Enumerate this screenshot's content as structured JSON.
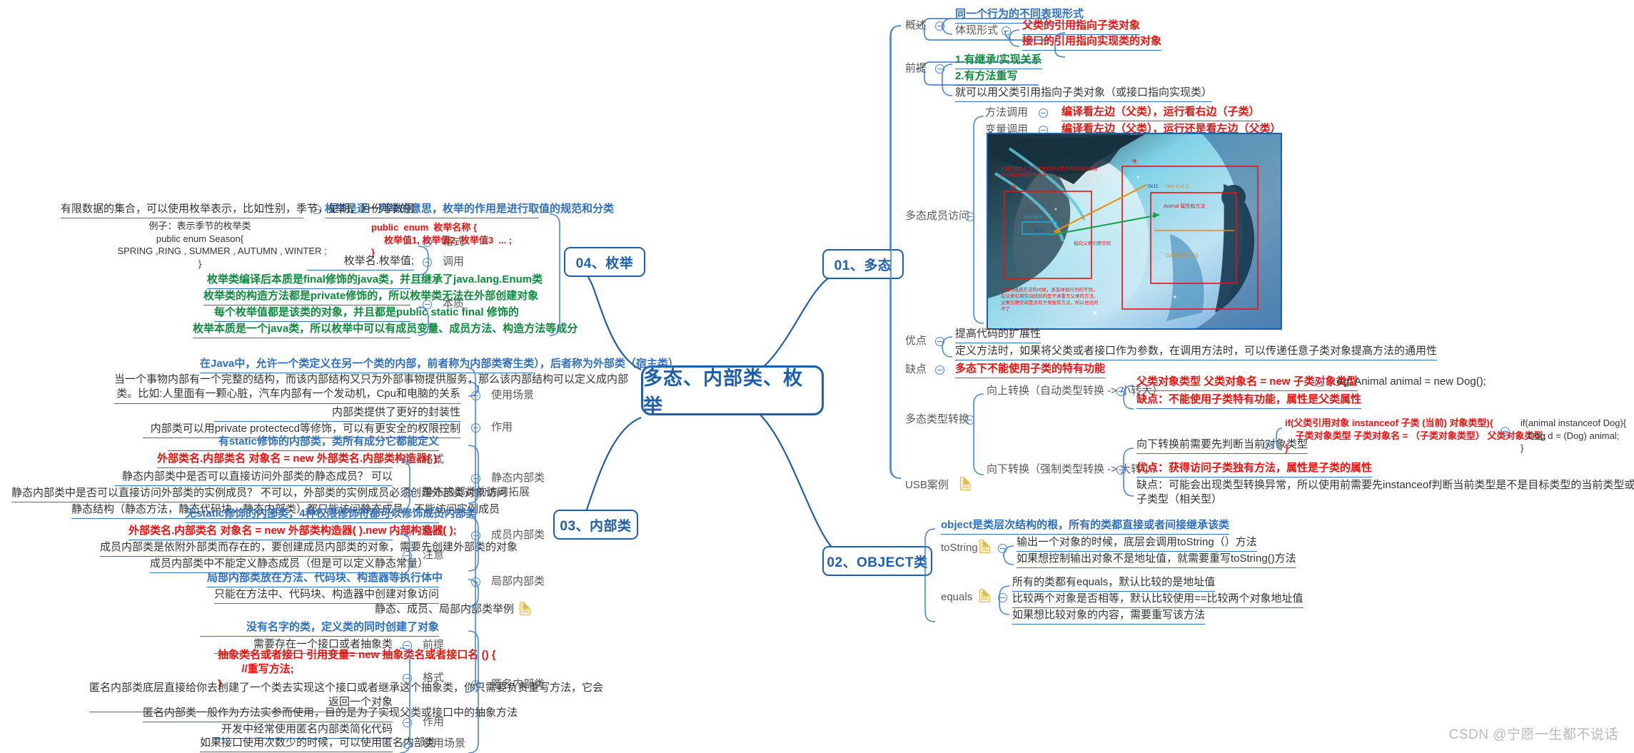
{
  "root": {
    "label": "多态、内部类、枚举"
  },
  "watermark": "CSDN @宁愿一生都不说话",
  "topics": [
    {
      "id": "t1",
      "label": "01、多态"
    },
    {
      "id": "t2",
      "label": "02、OBJECT类"
    },
    {
      "id": "t3",
      "label": "03、内部类"
    },
    {
      "id": "t4",
      "label": "04、枚举"
    }
  ],
  "polymorphism": {
    "overview_label": "概述",
    "overview_1": "同一个行为的不同表现形式",
    "form_label": "体现形式",
    "form_1": "父类的引用指向子类对象",
    "form_2": "接口的引用指向实现类的对象",
    "premise_label": "前提",
    "premise_1": "1.有继承/实现关系",
    "premise_2": "2.有方法重写",
    "premise_3": "就可以用父类引用指向子类对象（或接口指向实现类）",
    "member_access_label": "多态成员访问",
    "method_call_label": "方法调用",
    "method_call_value": "编译看左边（父类），运行看右边（子类）",
    "var_call_label": "变量调用",
    "var_call_value": "编译看左边（父类），运行还是看左边（父类）",
    "pros_label": "优点",
    "pros_1": "提高代码的扩展性",
    "pros_2": "定义方法时，如果将父类或者接口作为参数，在调用方法时，可以传递任意子类对象提高方法的通用性",
    "cons_label": "缺点",
    "cons_1": "多态下不能使用子类的特有功能",
    "cast_label": "多态类型转换",
    "up_label": "向上转换（自动类型转换 -> 小转大）",
    "up_format": "父类对象类型 父类对象名 = new 子类对象类型",
    "up_eg": "eg: Animal animal = new Dog();",
    "up_cons": "缺点：不能使用子类特有功能，属性是父类属性",
    "down_label": "向下转换（强制类型转换 -> 大转小）",
    "down_pre_label": "向下转换前需要先判断当前对象类型",
    "down_pre_code": "if(父类引用对象 instanceof 子类 (当前) 对象类型){\n    子类对象类型 子类对象名 = （子类对象类型） 父类对象类型;\n}",
    "down_pre_eg": "if(animal instanceof Dog){\n   Dog d = (Dog) animal;\n}",
    "down_pros": "优点：获得访问子类独有方法，属性是子类的属性",
    "down_cons": "缺点：可能会出现类型转换异常，所以使用前需要先instanceof判断当前类型是不是目标类型的当前类型或者\n子类型（相关型）",
    "usb_label": "USB案例",
    "image": {
      "caption_top": "1.访问成员方法的时候找到父类引用空间的属性\n所以输出的是父类结果",
      "caption_bottom": "2.访问成员方法的时候，多态体现行为的不同，\n在父类引用空间找到的是子类重写父类的方法。\n父类引用空间是没有子类独有方法，所以也访问\n不了",
      "stack_label": "栈",
      "heap_label": "堆",
      "ref_name": "Animal a",
      "ref_addr": "0x11",
      "heap_addr": "0x11",
      "heap_new": "new Cat ()",
      "heap_box1": "Animal 属性和方法",
      "heap_box2": "Cat属性和方法",
      "arrow_note": "指向父类引用空间"
    }
  },
  "object_class": {
    "root_note": "object是类层次结构的根，所有的类都直接或者间接继承该类",
    "tostring_label": "toString",
    "tostring_1": "输出一个对象的时候，底层会调用toString（）方法",
    "tostring_2": "如果想控制输出对象不是地址值，就需要重写toString()方法",
    "equals_label": "equals",
    "equals_1": "所有的类都有equals，默认比较的是地址值",
    "equals_2": "比较两个对象是否相等，默认比较使用==比较两个对象地址值",
    "equals_3": "如果想比较对象的内容，需要重写该方法"
  },
  "inner_class": {
    "def": "在Java中，允许一个类定义在另一个类的内部，前者称为内部类寄生类），后者称为外部类（宿主类）",
    "usecase_label": "使用场景",
    "usecase_1": "当一个事物内部有一个完整的结构，而该内部结构又只为外部事物提供服务，那么该内部结构可以定义成内部\n类。比如:人里面有一颗心脏，汽车内部有一个发动机，Cpu和电脑的关系",
    "role_label": "作用",
    "role_1": "内部类提供了更好的封装性",
    "role_2": "内部类可以用private protectecd等修饰，可以有更安全的权限控制",
    "static_label": "静态内部类",
    "static_def": "有static修饰的内部类，类所有成分它都能定义",
    "static_format_label": "格式",
    "static_format": "外部类名.内部类名 对象名 = new 外部类名.内部类构造器( );",
    "static_access_label": "静态内部类的访问拓展",
    "static_access_1": "静态内部类中是否可以直接访问外部类的静态成员？ 可以",
    "static_access_2": "静态内部类中是否可以直接访问外部类的实例成员？ 不可以，外部类的实例成员必须创建外部类对象访问",
    "static_access_3": "静态结构（静态方法，静态代码块，静态内部类）都只能访问静态成员，不能访问实例成员",
    "member_label": "成员内部类",
    "member_def": "无static修饰的内部类，4种权限修饰符都可以修饰成员内部类",
    "member_format_label": "格式",
    "member_format": "外部类名.内部类名 对象名 = new 外部类构造器( ).new 内部构造器( );",
    "member_note_label": "注意",
    "member_note_1": "成员内部类是依附外部类而存在的，要创建成员内部类的对象，需要先创建外部类的对象",
    "member_note_2": "成员内部类中不能定义静态成员（但是可以定义静态常量）",
    "local_label": "局部内部类",
    "local_1": "局部内部类放在方法、代码块、构造器等执行体中",
    "local_2": "只能在方法中、代码块、构造器中创建对象访问",
    "example_label": "静态、成员、局部内部类举例",
    "anon_label": "匿名内部类",
    "anon_def": "没有名字的类，定义类的同时创建了对象",
    "anon_pre_label": "前提",
    "anon_pre": "需要存在一个接口或者抽象类",
    "anon_format_label": "格式",
    "anon_format": "抽象类名或者接口 引用变量= new 抽象类名或者接口名 () {\n        //重写方法;\n}",
    "anon_note": "匿名内部类底层直接给你去创建了一个类去实现这个接口或者继承这个抽象类，你只需要负责重写方法，它会\n返回一个对象",
    "anon_role_label": "作用",
    "anon_role_1": "匿名内部类一般作为方法实参而使用，目的是为了实现父类或接口中的抽象方法",
    "anon_role_2": "开发中经常使用匿名内部类简化代码",
    "anon_usecase_label": "使用场景",
    "anon_usecase": "如果接口使用次数少的时候，可以使用匿名内部类"
  },
  "enumeration": {
    "def": "枚举是逐一列举的意思，枚举的作用是进行取值的规范和分类",
    "def_left": "有限数据的集合，可以使用枚举表示，比如性别，季节，星期，月份等数据",
    "example": "例子：表示季节的枚举类\npublic enum Season{\n    SPRING ,RING , SUMMER , AUTUMN , WINTER ;\n}",
    "format_label": "格式",
    "format_code": "public  enum  枚举名称 {\n     枚举值1, 枚举值2, 枚举值3  ... ;\n}",
    "call_label": "调用",
    "call_code": "枚举名.枚举值;",
    "essence_label": "本质",
    "essence_1": "枚举类编译后本质是final修饰的java类，并且继承了java.lang.Enum类",
    "essence_2": "枚举类的构造方法都是private修饰的，所以枚举类无法在外部创建对象",
    "essence_3": "每个枚举值都是该类的对象，并且都是public static final 修饰的",
    "essence_4": "枚举本质是一个java类，所以枚举中可以有成员变量、成员方法、构造方法等成分"
  },
  "colors": {
    "accent": "#1e5fad",
    "blue_text": "#2f6fc0",
    "red_text": "#e8130f",
    "green_text": "#0d8a3e",
    "grey_text": "#585858"
  }
}
